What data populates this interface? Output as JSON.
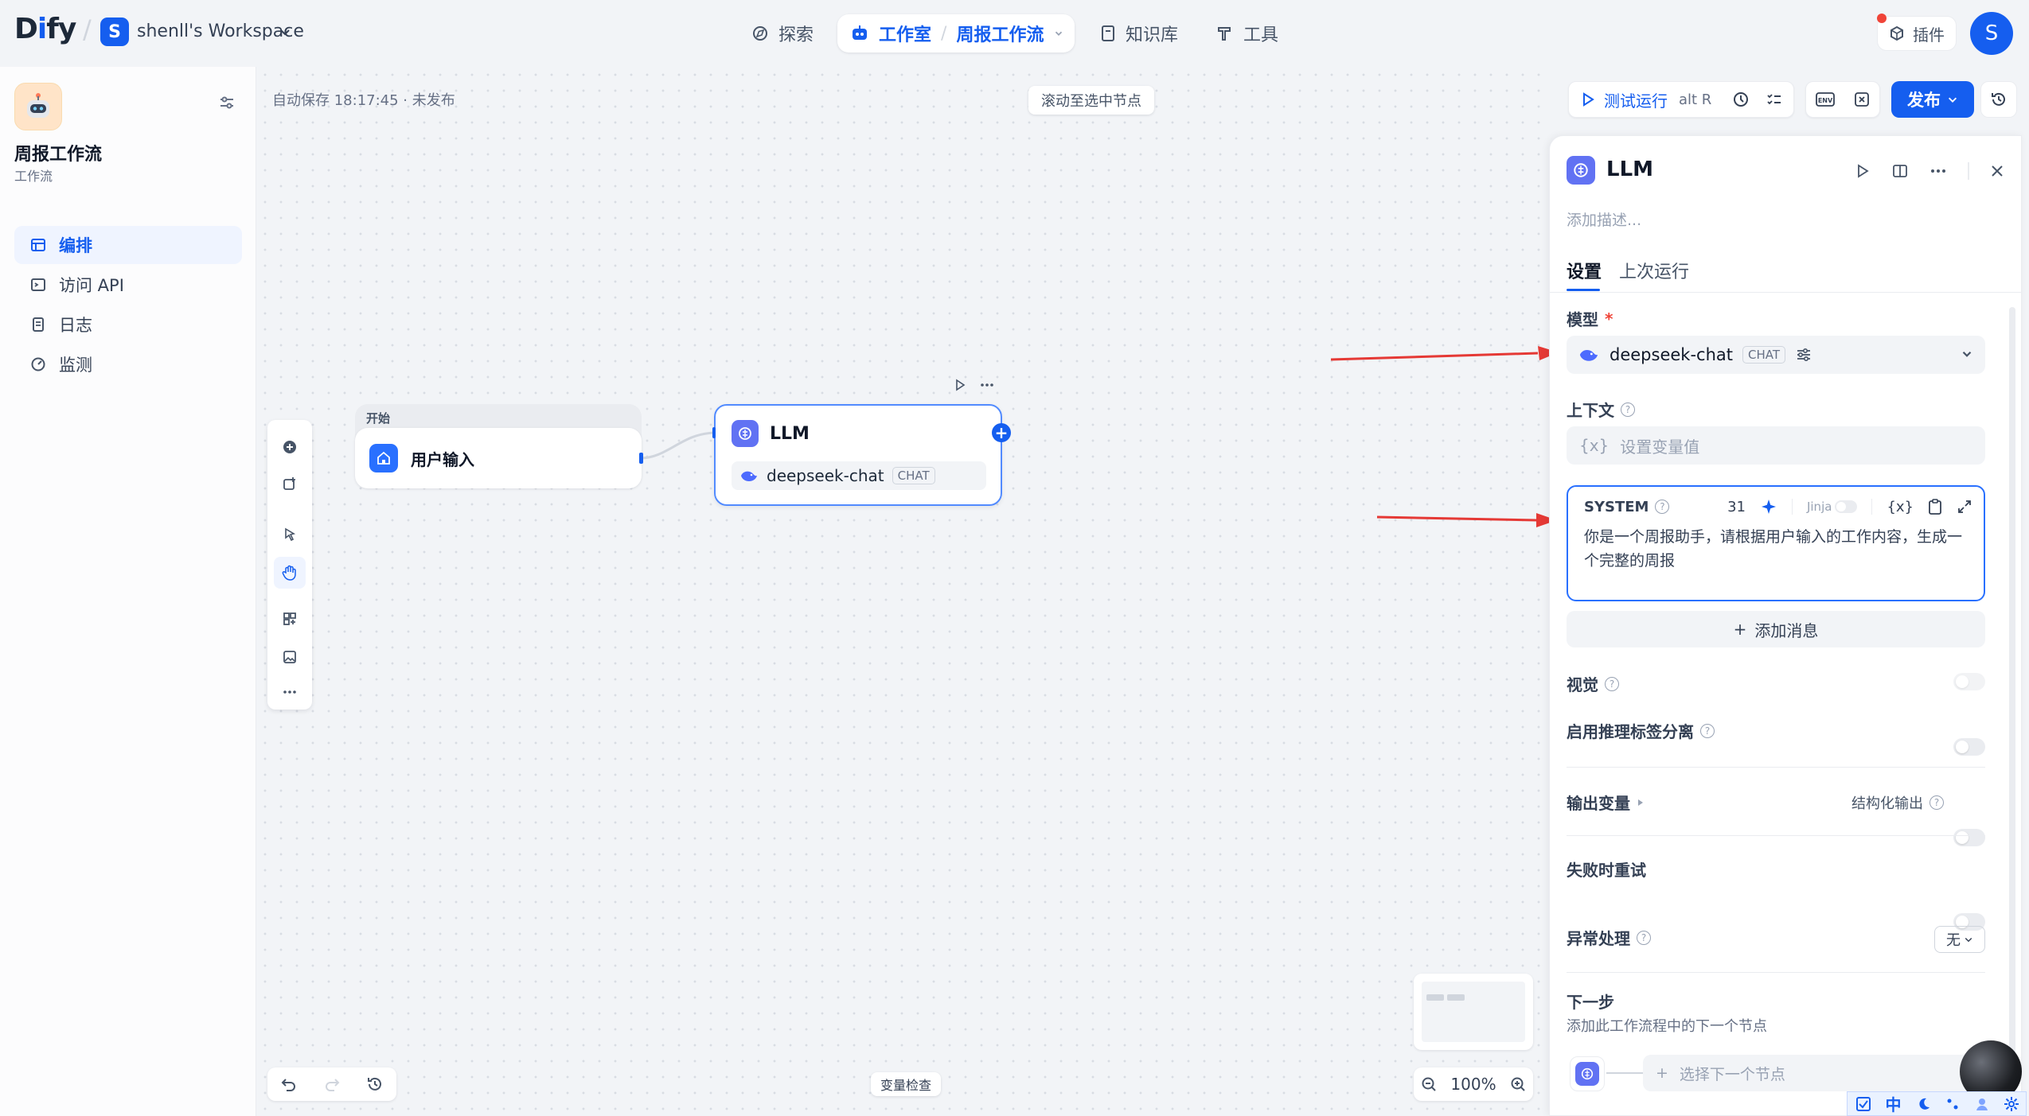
{
  "header": {
    "logo": "Dify",
    "workspace_initial": "S",
    "workspace_name": "shenll's Workspace",
    "nav": {
      "explore": "探索",
      "studio": "工作室",
      "current_app": "周报工作流",
      "knowledge": "知识库",
      "tools": "工具"
    },
    "plugins": "插件",
    "user_initial": "S"
  },
  "sidebar": {
    "app_title": "周报工作流",
    "app_type": "工作流",
    "items": [
      {
        "label": "编排",
        "icon": "layout-icon",
        "active": true
      },
      {
        "label": "访问 API",
        "icon": "terminal-icon",
        "active": false
      },
      {
        "label": "日志",
        "icon": "file-icon",
        "active": false
      },
      {
        "label": "监测",
        "icon": "gauge-icon",
        "active": false
      }
    ]
  },
  "canvas": {
    "autosave": "自动保存 18:17:45 · 未发布",
    "scroll_to_selected": "滚动至选中节点",
    "test_run": "测试运行",
    "test_run_kbd": "alt  R",
    "publish": "发布",
    "env": "ENV",
    "zoom": "100%",
    "var_inspect": "变量检查",
    "nodes": {
      "start_label": "开始",
      "start_title": "用户输入",
      "llm_title": "LLM",
      "llm_model": "deepseek-chat",
      "llm_model_tag": "CHAT"
    }
  },
  "panel": {
    "title": "LLM",
    "desc_placeholder": "添加描述...",
    "tabs": [
      "设置",
      "上次运行"
    ],
    "model_label": "模型",
    "model_name": "deepseek-chat",
    "model_tag": "CHAT",
    "context_label": "上下文",
    "context_placeholder": "设置变量值",
    "var_symbol": "{x}",
    "system": {
      "label": "SYSTEM",
      "token_count": "31",
      "jinja": "Jinja",
      "text": "你是一个周报助手，请根据用户输入的工作内容，生成一个完整的周报"
    },
    "add_message": "添加消息",
    "vision": "视觉",
    "reasoning_sep": "启用推理标签分离",
    "output_vars": "输出变量",
    "structured_output": "结构化输出",
    "retry": "失败时重试",
    "error_handling": "异常处理",
    "error_handling_value": "无",
    "next_step": "下一步",
    "next_step_desc": "添加此工作流程中的下一个节点",
    "select_next": "选择下一个节点"
  },
  "tray": {
    "ime": "中"
  },
  "colors": {
    "accent": "#155eef",
    "arrow": "#e53935",
    "llm_icon": "#6172f3"
  }
}
